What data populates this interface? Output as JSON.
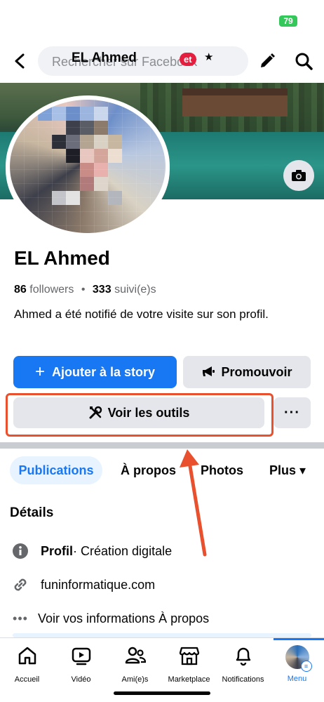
{
  "status_bar": {
    "battery": "79"
  },
  "top_nav": {
    "search_placeholder": "Rechercher sur Facebook",
    "profile_title": "EL Ahmed",
    "badge": "et",
    "icons": [
      "back-arrow-icon",
      "pencil-icon",
      "search-icon",
      "star-icon"
    ]
  },
  "cover": {
    "camera_icon": "camera-icon"
  },
  "profile": {
    "name": "EL Ahmed",
    "followers_count": "86",
    "followers_label": "followers",
    "separator": "•",
    "following_count": "333",
    "following_label": "suivi(e)s",
    "bio": "Ahmed a été notifié de votre visite sur son profil."
  },
  "actions": {
    "add_story": "Ajouter à la story",
    "add_story_prefix": "+",
    "promote": "Promouvoir",
    "tools": "Voir les outils",
    "more": "···"
  },
  "tabs": [
    {
      "label": "Publications",
      "active": true
    },
    {
      "label": "À propos",
      "active": false
    },
    {
      "label": "Photos",
      "active": false
    },
    {
      "label": "Plus ▾",
      "active": false
    }
  ],
  "details": {
    "title": "Détails",
    "profile_type_label": "Profil",
    "profile_type_value": " · Création digitale",
    "website": "funinformatique.com",
    "more_info": "Voir vos informations À propos"
  },
  "bottom_nav": [
    {
      "label": "Accueil",
      "icon": "home-icon"
    },
    {
      "label": "Vidéo",
      "icon": "video-icon"
    },
    {
      "label": "Ami(e)s",
      "icon": "friends-icon"
    },
    {
      "label": "Marketplace",
      "icon": "marketplace-icon"
    },
    {
      "label": "Notifications",
      "icon": "bell-icon"
    },
    {
      "label": "Menu",
      "icon": "avatar",
      "active": true
    }
  ],
  "colors": {
    "accent": "#1877f2",
    "highlight": "#e8502e",
    "button_gray": "#e4e6eb"
  }
}
